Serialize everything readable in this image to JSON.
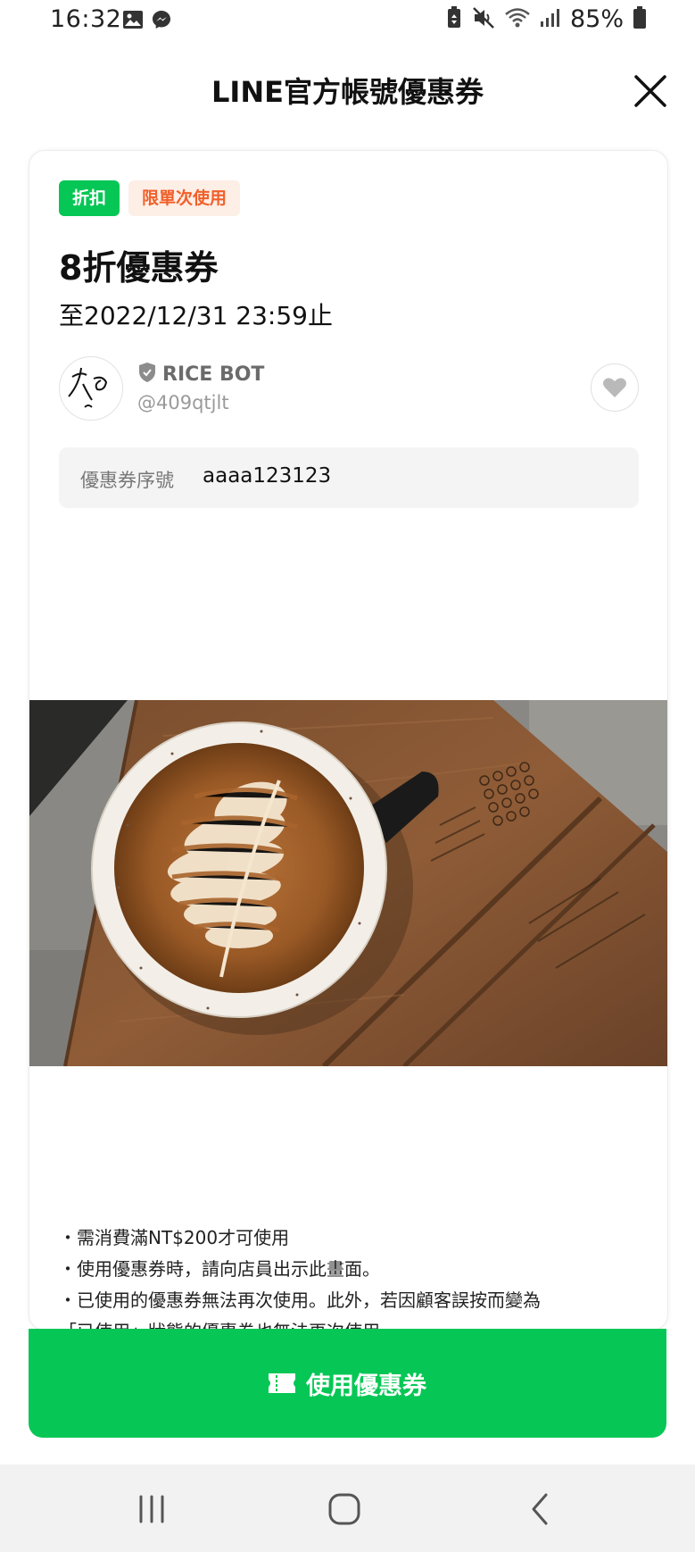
{
  "status_bar": {
    "time": "16:32",
    "battery": "85%"
  },
  "header": {
    "title": "LINE官方帳號優惠券"
  },
  "coupon": {
    "badges": {
      "type": "折扣",
      "usage": "限單次使用"
    },
    "title": "8折優惠券",
    "expiry": "至2022/12/31 23:59止",
    "account": {
      "name": "RICE BOT",
      "id": "@409qtjlt"
    },
    "serial": {
      "label": "優惠券序號",
      "value": "aaaa123123"
    },
    "notes": [
      "・需消費滿NT$200才可使用",
      "・使用優惠券時，請向店員出示此畫面。",
      "・已使用的優惠券無法再次使用。此外，若因顧客誤按而變為",
      "「已使用」狀態的優惠券也無法再次使用。"
    ]
  },
  "use_button": {
    "label": "使用優惠券"
  },
  "colors": {
    "line_green": "#06c755",
    "badge_orange": "#f1602a",
    "badge_orange_bg": "#fdeee6"
  },
  "icons": {
    "gallery": "image-icon",
    "messenger": "messenger-icon",
    "close": "close-icon",
    "verified": "shield-icon",
    "favorite": "heart-icon",
    "ticket": "ticket-icon"
  }
}
